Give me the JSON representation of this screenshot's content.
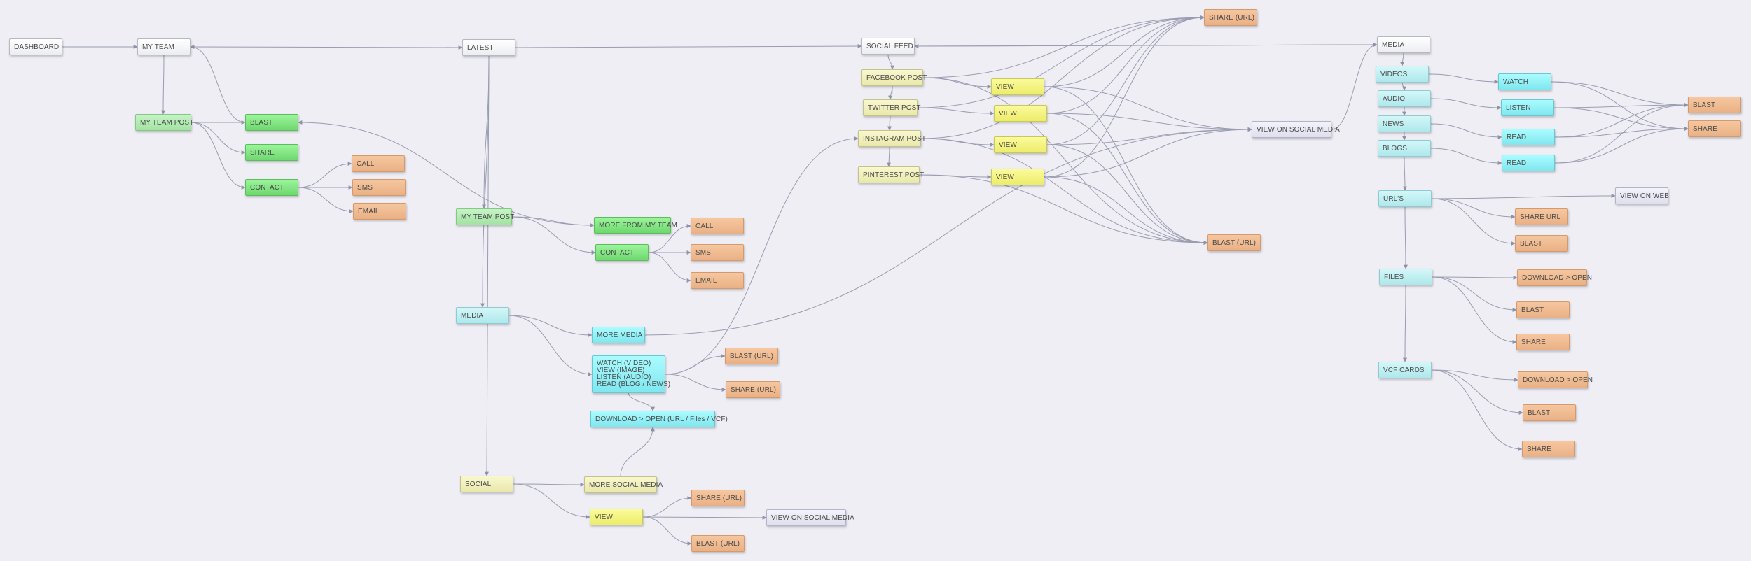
{
  "colors": {
    "background": "#efeef5",
    "edge": "#9a9cb0",
    "white": "#f7f7f9",
    "green": "#86e886",
    "orange": "#f0bc92",
    "cyan": "#95f1f6",
    "light_cyan": "#c0eff1",
    "light_green": "#b4ebb4",
    "yellow": "#f4f482",
    "light_yellow": "#f1f0bd",
    "lavender": "#e8e8f4"
  },
  "nodes": [
    {
      "id": "dashboard",
      "label": "DASHBOARD",
      "color": "white"
    },
    {
      "id": "myteam",
      "label": "MY TEAM",
      "color": "white"
    },
    {
      "id": "latest",
      "label": "LATEST",
      "color": "white"
    },
    {
      "id": "socialfeed",
      "label": "SOCIAL FEED",
      "color": "white"
    },
    {
      "id": "media_top",
      "label": "MEDIA",
      "color": "white"
    },
    {
      "id": "share_url_top",
      "label": "SHARE (URL)",
      "color": "orange"
    },
    {
      "id": "myteampost1",
      "label": "MY TEAM POST",
      "color": "greenl"
    },
    {
      "id": "blast1",
      "label": "BLAST",
      "color": "green"
    },
    {
      "id": "share1",
      "label": "SHARE",
      "color": "green"
    },
    {
      "id": "contact1",
      "label": "CONTACT",
      "color": "green"
    },
    {
      "id": "call1",
      "label": "CALL",
      "color": "orange"
    },
    {
      "id": "sms1",
      "label": "SMS",
      "color": "orange"
    },
    {
      "id": "email1",
      "label": "EMAIL",
      "color": "orange"
    },
    {
      "id": "myteampost2",
      "label": "MY TEAM POST",
      "color": "greenl"
    },
    {
      "id": "morefromteam",
      "label": "MORE FROM MY TEAM",
      "color": "green"
    },
    {
      "id": "contact2",
      "label": "CONTACT",
      "color": "green"
    },
    {
      "id": "call2",
      "label": "CALL",
      "color": "orange"
    },
    {
      "id": "sms2",
      "label": "SMS",
      "color": "orange"
    },
    {
      "id": "email2",
      "label": "EMAIL",
      "color": "orange"
    },
    {
      "id": "media_mid",
      "label": "MEDIA",
      "color": "cyanl"
    },
    {
      "id": "moremedia",
      "label": "MORE MEDIA",
      "color": "cyan"
    },
    {
      "id": "watchview",
      "label": "WATCH (VIDEO)\nVIEW (IMAGE)\nLISTEN (AUDIO)\nREAD (BLOG / NEWS)",
      "color": "cyan",
      "multi": true
    },
    {
      "id": "blasturl_mid",
      "label": "BLAST (URL)",
      "color": "orange"
    },
    {
      "id": "shareurl_mid",
      "label": "SHARE (URL)",
      "color": "orange"
    },
    {
      "id": "download_mid",
      "label": "DOWNLOAD > OPEN (URL / Files / VCF)",
      "color": "cyan"
    },
    {
      "id": "social",
      "label": "SOCIAL",
      "color": "yellowl"
    },
    {
      "id": "moresocial",
      "label": "MORE SOCIAL MEDIA",
      "color": "yellowl"
    },
    {
      "id": "view_soc",
      "label": "VIEW",
      "color": "yellow"
    },
    {
      "id": "shareurl_soc",
      "label": "SHARE (URL)",
      "color": "orange"
    },
    {
      "id": "blasturl_soc",
      "label": "BLAST (URL)",
      "color": "orange"
    },
    {
      "id": "viewsocial_bottom",
      "label": "VIEW ON SOCIAL MEDIA",
      "color": "lav"
    },
    {
      "id": "fbpost",
      "label": "FACEBOOK POST",
      "color": "yellowl"
    },
    {
      "id": "twpost",
      "label": "TWITTER POST",
      "color": "yellowl"
    },
    {
      "id": "igpost",
      "label": "INSTAGRAM POST",
      "color": "yellowl"
    },
    {
      "id": "pinpost",
      "label": "PINTEREST POST",
      "color": "yellowl"
    },
    {
      "id": "view1",
      "label": "VIEW",
      "color": "yellow"
    },
    {
      "id": "view2",
      "label": "VIEW",
      "color": "yellow"
    },
    {
      "id": "view3",
      "label": "VIEW",
      "color": "yellow"
    },
    {
      "id": "view4",
      "label": "VIEW",
      "color": "yellow"
    },
    {
      "id": "viewsocial_mid",
      "label": "VIEW ON SOCIAL MEDIA",
      "color": "lav"
    },
    {
      "id": "blasturl_right",
      "label": "BLAST (URL)",
      "color": "orange"
    },
    {
      "id": "videos",
      "label": "VIDEOS",
      "color": "cyanl"
    },
    {
      "id": "audio",
      "label": "AUDIO",
      "color": "cyanl"
    },
    {
      "id": "news",
      "label": "NEWS",
      "color": "cyanl"
    },
    {
      "id": "blogs",
      "label": "BLOGS",
      "color": "cyanl"
    },
    {
      "id": "watch",
      "label": "WATCH",
      "color": "cyan"
    },
    {
      "id": "listen",
      "label": "LISTEN",
      "color": "cyan"
    },
    {
      "id": "read1",
      "label": "READ",
      "color": "cyan"
    },
    {
      "id": "read2",
      "label": "READ",
      "color": "cyan"
    },
    {
      "id": "blast_far",
      "label": "BLAST",
      "color": "orange"
    },
    {
      "id": "share_far",
      "label": "SHARE",
      "color": "orange"
    },
    {
      "id": "urls",
      "label": "URL'S",
      "color": "cyanl"
    },
    {
      "id": "viewonweb",
      "label": "VIEW ON WEB",
      "color": "lav"
    },
    {
      "id": "shareurl_r",
      "label": "SHARE URL",
      "color": "orange"
    },
    {
      "id": "blast_url_r",
      "label": "BLAST",
      "color": "orange"
    },
    {
      "id": "files",
      "label": "FILES",
      "color": "cyanl"
    },
    {
      "id": "dl_files",
      "label": "DOWNLOAD > OPEN",
      "color": "orange"
    },
    {
      "id": "blast_files",
      "label": "BLAST",
      "color": "orange"
    },
    {
      "id": "share_files",
      "label": "SHARE",
      "color": "orange"
    },
    {
      "id": "vcf",
      "label": "VCF CARDS",
      "color": "cyanl"
    },
    {
      "id": "dl_vcf",
      "label": "DOWNLOAD > OPEN",
      "color": "orange"
    },
    {
      "id": "blast_vcf",
      "label": "BLAST",
      "color": "orange"
    },
    {
      "id": "share_vcf",
      "label": "SHARE",
      "color": "orange"
    }
  ],
  "edges": [
    [
      "dashboard",
      "myteam"
    ],
    [
      "myteam",
      "latest"
    ],
    [
      "latest",
      "socialfeed"
    ],
    [
      "media_top",
      "socialfeed"
    ],
    [
      "socialfeed",
      "media_top"
    ],
    [
      "myteam",
      "myteampost1"
    ],
    [
      "blast1",
      "myteam"
    ],
    [
      "myteampost1",
      "blast1"
    ],
    [
      "myteampost1",
      "share1"
    ],
    [
      "myteampost1",
      "contact1"
    ],
    [
      "contact1",
      "call1"
    ],
    [
      "contact1",
      "sms1"
    ],
    [
      "contact1",
      "email1"
    ],
    [
      "latest",
      "myteampost2"
    ],
    [
      "latest",
      "media_mid"
    ],
    [
      "latest",
      "social"
    ],
    [
      "myteampost2",
      "morefromteam"
    ],
    [
      "myteampost2",
      "contact2"
    ],
    [
      "morefromteam",
      "blast1"
    ],
    [
      "contact2",
      "call2"
    ],
    [
      "contact2",
      "sms2"
    ],
    [
      "contact2",
      "email2"
    ],
    [
      "media_mid",
      "moremedia"
    ],
    [
      "media_mid",
      "watchview"
    ],
    [
      "watchview",
      "blasturl_mid"
    ],
    [
      "watchview",
      "shareurl_mid"
    ],
    [
      "watchview",
      "download_mid"
    ],
    [
      "watchview",
      "igpost"
    ],
    [
      "moremedia",
      "viewsocial_mid"
    ],
    [
      "social",
      "moresocial"
    ],
    [
      "social",
      "view_soc"
    ],
    [
      "moresocial",
      "download_mid"
    ],
    [
      "view_soc",
      "shareurl_soc"
    ],
    [
      "view_soc",
      "blasturl_soc"
    ],
    [
      "view_soc",
      "viewsocial_bottom"
    ],
    [
      "socialfeed",
      "fbpost"
    ],
    [
      "fbpost",
      "twpost"
    ],
    [
      "twpost",
      "igpost"
    ],
    [
      "igpost",
      "pinpost"
    ],
    [
      "fbpost",
      "igpost"
    ],
    [
      "fbpost",
      "view1"
    ],
    [
      "twpost",
      "view2"
    ],
    [
      "igpost",
      "view3"
    ],
    [
      "pinpost",
      "view4"
    ],
    [
      "fbpost",
      "share_url_top"
    ],
    [
      "twpost",
      "share_url_top"
    ],
    [
      "igpost",
      "share_url_top"
    ],
    [
      "view1",
      "share_url_top"
    ],
    [
      "view2",
      "share_url_top"
    ],
    [
      "view3",
      "share_url_top"
    ],
    [
      "view4",
      "share_url_top"
    ],
    [
      "view1",
      "viewsocial_mid"
    ],
    [
      "view2",
      "viewsocial_mid"
    ],
    [
      "view3",
      "viewsocial_mid"
    ],
    [
      "view4",
      "viewsocial_mid"
    ],
    [
      "view1",
      "blasturl_right"
    ],
    [
      "view2",
      "blasturl_right"
    ],
    [
      "view3",
      "blasturl_right"
    ],
    [
      "view4",
      "blasturl_right"
    ],
    [
      "fbpost",
      "blasturl_right"
    ],
    [
      "igpost",
      "blasturl_right"
    ],
    [
      "pinpost",
      "blasturl_right"
    ],
    [
      "viewsocial_mid",
      "media_top"
    ],
    [
      "media_top",
      "videos"
    ],
    [
      "videos",
      "audio"
    ],
    [
      "audio",
      "news"
    ],
    [
      "news",
      "blogs"
    ],
    [
      "blogs",
      "urls"
    ],
    [
      "urls",
      "files"
    ],
    [
      "files",
      "vcf"
    ],
    [
      "videos",
      "watch"
    ],
    [
      "audio",
      "listen"
    ],
    [
      "news",
      "read1"
    ],
    [
      "blogs",
      "read2"
    ],
    [
      "watch",
      "blast_far"
    ],
    [
      "watch",
      "share_far"
    ],
    [
      "listen",
      "blast_far"
    ],
    [
      "listen",
      "share_far"
    ],
    [
      "read1",
      "blast_far"
    ],
    [
      "read1",
      "share_far"
    ],
    [
      "read2",
      "blast_far"
    ],
    [
      "read2",
      "share_far"
    ],
    [
      "urls",
      "viewonweb"
    ],
    [
      "urls",
      "shareurl_r"
    ],
    [
      "urls",
      "blast_url_r"
    ],
    [
      "files",
      "dl_files"
    ],
    [
      "files",
      "blast_files"
    ],
    [
      "files",
      "share_files"
    ],
    [
      "vcf",
      "dl_vcf"
    ],
    [
      "vcf",
      "blast_vcf"
    ],
    [
      "vcf",
      "share_vcf"
    ]
  ]
}
